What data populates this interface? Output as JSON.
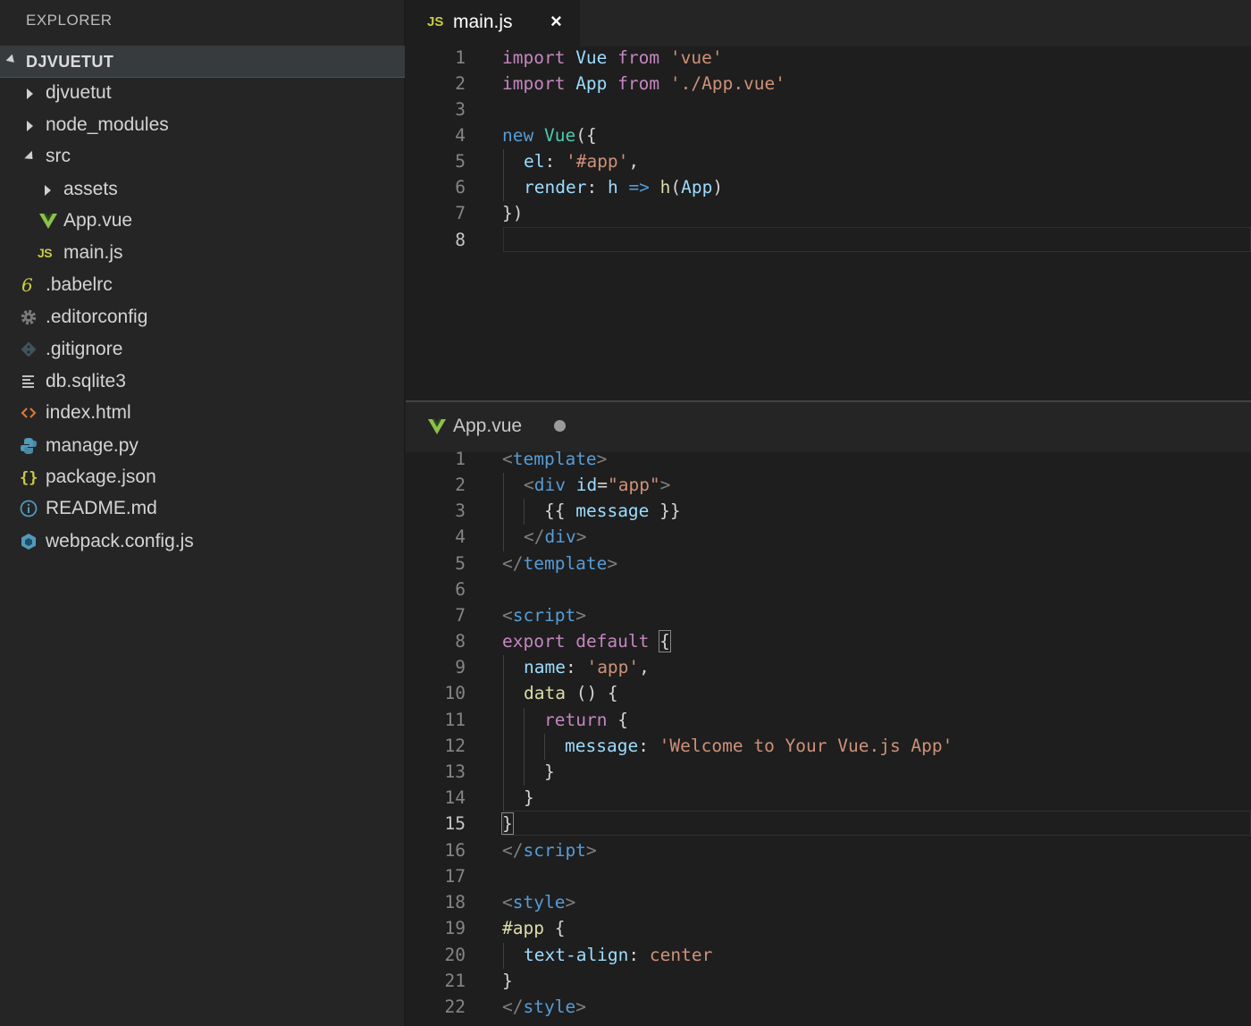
{
  "sidebar": {
    "title": "EXPLORER",
    "project": "DJVUETUT",
    "items": [
      {
        "label": "djvuetut",
        "icon": "folder-collapsed-caret"
      },
      {
        "label": "node_modules",
        "icon": "folder-collapsed-caret"
      },
      {
        "label": "src",
        "icon": "folder-expanded-caret"
      },
      {
        "label": "assets",
        "icon": "folder-collapsed-caret"
      },
      {
        "label": "App.vue",
        "icon": "vue-icon"
      },
      {
        "label": "main.js",
        "icon": "js-icon"
      },
      {
        "label": ".babelrc",
        "icon": "babel-icon"
      },
      {
        "label": ".editorconfig",
        "icon": "gear-icon"
      },
      {
        "label": ".gitignore",
        "icon": "git-icon"
      },
      {
        "label": "db.sqlite3",
        "icon": "lines-icon"
      },
      {
        "label": "index.html",
        "icon": "html-icon"
      },
      {
        "label": "manage.py",
        "icon": "python-icon"
      },
      {
        "label": "package.json",
        "icon": "json-icon"
      },
      {
        "label": "README.md",
        "icon": "info-icon"
      },
      {
        "label": "webpack.config.js",
        "icon": "webpack-icon"
      }
    ],
    "js_badge": "JS"
  },
  "editor_top": {
    "tab": {
      "label": "main.js",
      "icon_text": "JS",
      "close": "×"
    },
    "line_numbers": [
      "1",
      "2",
      "3",
      "4",
      "5",
      "6",
      "7",
      "8"
    ],
    "active_line": "8"
  },
  "editor_bottom": {
    "tab": {
      "label": "App.vue",
      "icon": "vue-icon",
      "modified": true
    },
    "line_numbers": [
      "1",
      "2",
      "3",
      "4",
      "5",
      "6",
      "7",
      "8",
      "9",
      "10",
      "11",
      "12",
      "13",
      "14",
      "15",
      "16",
      "17",
      "18",
      "19",
      "20",
      "21",
      "22"
    ],
    "active_line": "15"
  },
  "code": {
    "main": {
      "l1": [
        "import",
        " Vue ",
        "from",
        " ",
        "'vue'"
      ],
      "l2": [
        "import",
        " App ",
        "from",
        " ",
        "'./App.vue'"
      ],
      "l4": [
        "new",
        " ",
        "Vue",
        "({"
      ],
      "l5": [
        "el",
        ": ",
        "'#app'",
        ","
      ],
      "l6": [
        "render",
        ": ",
        "h",
        " ",
        "=>",
        " ",
        "h",
        "(",
        "App",
        ")"
      ],
      "l7": [
        "})"
      ]
    },
    "app": {
      "l1": [
        "<",
        "template",
        ">"
      ],
      "l2": [
        "<",
        "div",
        " ",
        "id",
        "=",
        "\"app\"",
        ">"
      ],
      "l3": [
        "{{ ",
        "message",
        " }}"
      ],
      "l4": [
        "</",
        "div",
        ">"
      ],
      "l5": [
        "</",
        "template",
        ">"
      ],
      "l7": [
        "<",
        "script",
        ">"
      ],
      "l8": [
        "export",
        " ",
        "default",
        " ",
        "{"
      ],
      "l9": [
        "name",
        ": ",
        "'app'",
        ","
      ],
      "l10": [
        "data",
        " () {"
      ],
      "l11": [
        "return",
        " {"
      ],
      "l12": [
        "message",
        ": ",
        "'Welcome to Your Vue.js App'"
      ],
      "l13": [
        "}"
      ],
      "l14": [
        "}"
      ],
      "l15": [
        "}"
      ],
      "l16": [
        "</",
        "script",
        ">"
      ],
      "l18": [
        "<",
        "style",
        ">"
      ],
      "l19": [
        "#app",
        " {"
      ],
      "l20": [
        "text-align",
        ": ",
        "center"
      ],
      "l21": [
        "}"
      ],
      "l22": [
        "</",
        "style",
        ">"
      ]
    }
  },
  "colors": {
    "keyword": "#c586c0",
    "storage": "#569cd6",
    "type": "#4ec9b0",
    "variable": "#9cdcfe",
    "string": "#ce9178",
    "function": "#dcdcaa",
    "vue_green": "#8dc149",
    "js_yellow": "#cbcb41"
  }
}
